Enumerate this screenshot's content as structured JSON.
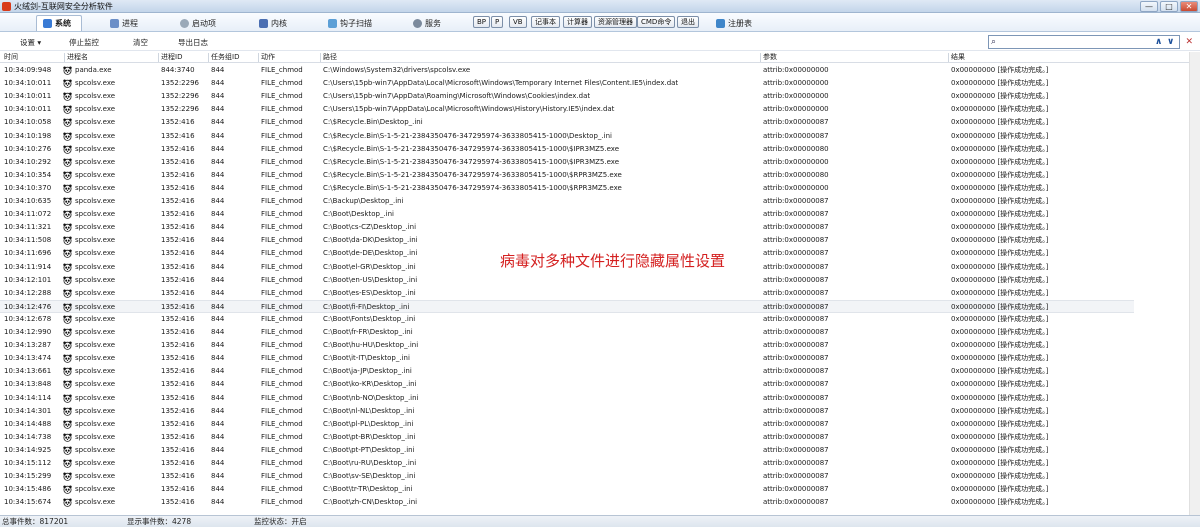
{
  "window": {
    "title": "火绒剑-互联网安全分析软件",
    "controls": [
      "—",
      "□",
      "✕"
    ]
  },
  "tabs": [
    {
      "label": "系统",
      "icon": "system-icon",
      "active": true
    },
    {
      "label": "进程",
      "icon": "process-icon"
    },
    {
      "label": "启动项",
      "icon": "startup-icon"
    },
    {
      "label": "内核",
      "icon": "kernel-icon"
    },
    {
      "label": "钩子扫描",
      "icon": "hook-scan-icon"
    },
    {
      "label": "服务",
      "icon": "service-icon"
    }
  ],
  "tools": [
    "BP",
    "P",
    "VB",
    "记事本",
    "计算器",
    "资源管理器",
    "CMD命令",
    "退出"
  ],
  "registry_label": "注册表",
  "actions": {
    "settings": "设置",
    "stop_monitor": "停止监控",
    "clear": "清空",
    "export_log": "导出日志"
  },
  "search": {
    "placeholder": ""
  },
  "columns": [
    "时间",
    "进程名",
    "进程ID",
    "任务组ID",
    "动作",
    "路径",
    "参数",
    "结果"
  ],
  "rows": [
    {
      "time": "10:34:09:948",
      "proc": "panda.exe",
      "pid": "844:3740",
      "gid": "844",
      "action": "FILE_chmod",
      "path": "C:\\Windows\\System32\\drivers\\spcolsv.exe",
      "param": "attrib:0x00000000",
      "result": "0x00000000 [操作成功完成。]"
    },
    {
      "time": "10:34:10:011",
      "proc": "spcolsv.exe",
      "pid": "1352:2296",
      "gid": "844",
      "action": "FILE_chmod",
      "path": "C:\\Users\\15pb-win7\\AppData\\Local\\Microsoft\\Windows\\Temporary Internet Files\\Content.IE5\\index.dat",
      "param": "attrib:0x00000000",
      "result": "0x00000000 [操作成功完成。]"
    },
    {
      "time": "10:34:10:011",
      "proc": "spcolsv.exe",
      "pid": "1352:2296",
      "gid": "844",
      "action": "FILE_chmod",
      "path": "C:\\Users\\15pb-win7\\AppData\\Roaming\\Microsoft\\Windows\\Cookies\\index.dat",
      "param": "attrib:0x00000000",
      "result": "0x00000000 [操作成功完成。]"
    },
    {
      "time": "10:34:10:011",
      "proc": "spcolsv.exe",
      "pid": "1352:2296",
      "gid": "844",
      "action": "FILE_chmod",
      "path": "C:\\Users\\15pb-win7\\AppData\\Local\\Microsoft\\Windows\\History\\History.IE5\\index.dat",
      "param": "attrib:0x00000000",
      "result": "0x00000000 [操作成功完成。]"
    },
    {
      "time": "10:34:10:058",
      "proc": "spcolsv.exe",
      "pid": "1352:416",
      "gid": "844",
      "action": "FILE_chmod",
      "path": "C:\\$Recycle.Bin\\Desktop_.ini",
      "param": "attrib:0x00000087",
      "result": "0x00000000 [操作成功完成。]"
    },
    {
      "time": "10:34:10:198",
      "proc": "spcolsv.exe",
      "pid": "1352:416",
      "gid": "844",
      "action": "FILE_chmod",
      "path": "C:\\$Recycle.Bin\\S-1-5-21-2384350476-347295974-3633805415-1000\\Desktop_.ini",
      "param": "attrib:0x00000087",
      "result": "0x00000000 [操作成功完成。]"
    },
    {
      "time": "10:34:10:276",
      "proc": "spcolsv.exe",
      "pid": "1352:416",
      "gid": "844",
      "action": "FILE_chmod",
      "path": "C:\\$Recycle.Bin\\S-1-5-21-2384350476-347295974-3633805415-1000\\$IPR3MZ5.exe",
      "param": "attrib:0x00000080",
      "result": "0x00000000 [操作成功完成。]"
    },
    {
      "time": "10:34:10:292",
      "proc": "spcolsv.exe",
      "pid": "1352:416",
      "gid": "844",
      "action": "FILE_chmod",
      "path": "C:\\$Recycle.Bin\\S-1-5-21-2384350476-347295974-3633805415-1000\\$IPR3MZ5.exe",
      "param": "attrib:0x00000000",
      "result": "0x00000000 [操作成功完成。]"
    },
    {
      "time": "10:34:10:354",
      "proc": "spcolsv.exe",
      "pid": "1352:416",
      "gid": "844",
      "action": "FILE_chmod",
      "path": "C:\\$Recycle.Bin\\S-1-5-21-2384350476-347295974-3633805415-1000\\$RPR3MZ5.exe",
      "param": "attrib:0x00000080",
      "result": "0x00000000 [操作成功完成。]"
    },
    {
      "time": "10:34:10:370",
      "proc": "spcolsv.exe",
      "pid": "1352:416",
      "gid": "844",
      "action": "FILE_chmod",
      "path": "C:\\$Recycle.Bin\\S-1-5-21-2384350476-347295974-3633805415-1000\\$RPR3MZ5.exe",
      "param": "attrib:0x00000000",
      "result": "0x00000000 [操作成功完成。]"
    },
    {
      "time": "10:34:10:635",
      "proc": "spcolsv.exe",
      "pid": "1352:416",
      "gid": "844",
      "action": "FILE_chmod",
      "path": "C:\\Backup\\Desktop_.ini",
      "param": "attrib:0x00000087",
      "result": "0x00000000 [操作成功完成。]"
    },
    {
      "time": "10:34:11:072",
      "proc": "spcolsv.exe",
      "pid": "1352:416",
      "gid": "844",
      "action": "FILE_chmod",
      "path": "C:\\Boot\\Desktop_.ini",
      "param": "attrib:0x00000087",
      "result": "0x00000000 [操作成功完成。]"
    },
    {
      "time": "10:34:11:321",
      "proc": "spcolsv.exe",
      "pid": "1352:416",
      "gid": "844",
      "action": "FILE_chmod",
      "path": "C:\\Boot\\cs-CZ\\Desktop_.ini",
      "param": "attrib:0x00000087",
      "result": "0x00000000 [操作成功完成。]"
    },
    {
      "time": "10:34:11:508",
      "proc": "spcolsv.exe",
      "pid": "1352:416",
      "gid": "844",
      "action": "FILE_chmod",
      "path": "C:\\Boot\\da-DK\\Desktop_.ini",
      "param": "attrib:0x00000087",
      "result": "0x00000000 [操作成功完成。]"
    },
    {
      "time": "10:34:11:696",
      "proc": "spcolsv.exe",
      "pid": "1352:416",
      "gid": "844",
      "action": "FILE_chmod",
      "path": "C:\\Boot\\de-DE\\Desktop_.ini",
      "param": "attrib:0x00000087",
      "result": "0x00000000 [操作成功完成。]"
    },
    {
      "time": "10:34:11:914",
      "proc": "spcolsv.exe",
      "pid": "1352:416",
      "gid": "844",
      "action": "FILE_chmod",
      "path": "C:\\Boot\\el-GR\\Desktop_.ini",
      "param": "attrib:0x00000087",
      "result": "0x00000000 [操作成功完成。]"
    },
    {
      "time": "10:34:12:101",
      "proc": "spcolsv.exe",
      "pid": "1352:416",
      "gid": "844",
      "action": "FILE_chmod",
      "path": "C:\\Boot\\en-US\\Desktop_.ini",
      "param": "attrib:0x00000087",
      "result": "0x00000000 [操作成功完成。]"
    },
    {
      "time": "10:34:12:288",
      "proc": "spcolsv.exe",
      "pid": "1352:416",
      "gid": "844",
      "action": "FILE_chmod",
      "path": "C:\\Boot\\es-ES\\Desktop_.ini",
      "param": "attrib:0x00000087",
      "result": "0x00000000 [操作成功完成。]"
    },
    {
      "time": "10:34:12:476",
      "proc": "spcolsv.exe",
      "pid": "1352:416",
      "gid": "844",
      "action": "FILE_chmod",
      "path": "C:\\Boot\\fi-FI\\Desktop_.ini",
      "param": "attrib:0x00000087",
      "result": "0x00000000 [操作成功完成。]",
      "selected": true
    },
    {
      "time": "10:34:12:678",
      "proc": "spcolsv.exe",
      "pid": "1352:416",
      "gid": "844",
      "action": "FILE_chmod",
      "path": "C:\\Boot\\Fonts\\Desktop_.ini",
      "param": "attrib:0x00000087",
      "result": "0x00000000 [操作成功完成。]"
    },
    {
      "time": "10:34:12:990",
      "proc": "spcolsv.exe",
      "pid": "1352:416",
      "gid": "844",
      "action": "FILE_chmod",
      "path": "C:\\Boot\\fr-FR\\Desktop_.ini",
      "param": "attrib:0x00000087",
      "result": "0x00000000 [操作成功完成。]"
    },
    {
      "time": "10:34:13:287",
      "proc": "spcolsv.exe",
      "pid": "1352:416",
      "gid": "844",
      "action": "FILE_chmod",
      "path": "C:\\Boot\\hu-HU\\Desktop_.ini",
      "param": "attrib:0x00000087",
      "result": "0x00000000 [操作成功完成。]"
    },
    {
      "time": "10:34:13:474",
      "proc": "spcolsv.exe",
      "pid": "1352:416",
      "gid": "844",
      "action": "FILE_chmod",
      "path": "C:\\Boot\\it-IT\\Desktop_.ini",
      "param": "attrib:0x00000087",
      "result": "0x00000000 [操作成功完成。]"
    },
    {
      "time": "10:34:13:661",
      "proc": "spcolsv.exe",
      "pid": "1352:416",
      "gid": "844",
      "action": "FILE_chmod",
      "path": "C:\\Boot\\ja-JP\\Desktop_.ini",
      "param": "attrib:0x00000087",
      "result": "0x00000000 [操作成功完成。]"
    },
    {
      "time": "10:34:13:848",
      "proc": "spcolsv.exe",
      "pid": "1352:416",
      "gid": "844",
      "action": "FILE_chmod",
      "path": "C:\\Boot\\ko-KR\\Desktop_.ini",
      "param": "attrib:0x00000087",
      "result": "0x00000000 [操作成功完成。]"
    },
    {
      "time": "10:34:14:114",
      "proc": "spcolsv.exe",
      "pid": "1352:416",
      "gid": "844",
      "action": "FILE_chmod",
      "path": "C:\\Boot\\nb-NO\\Desktop_.ini",
      "param": "attrib:0x00000087",
      "result": "0x00000000 [操作成功完成。]"
    },
    {
      "time": "10:34:14:301",
      "proc": "spcolsv.exe",
      "pid": "1352:416",
      "gid": "844",
      "action": "FILE_chmod",
      "path": "C:\\Boot\\nl-NL\\Desktop_.ini",
      "param": "attrib:0x00000087",
      "result": "0x00000000 [操作成功完成。]"
    },
    {
      "time": "10:34:14:488",
      "proc": "spcolsv.exe",
      "pid": "1352:416",
      "gid": "844",
      "action": "FILE_chmod",
      "path": "C:\\Boot\\pl-PL\\Desktop_.ini",
      "param": "attrib:0x00000087",
      "result": "0x00000000 [操作成功完成。]"
    },
    {
      "time": "10:34:14:738",
      "proc": "spcolsv.exe",
      "pid": "1352:416",
      "gid": "844",
      "action": "FILE_chmod",
      "path": "C:\\Boot\\pt-BR\\Desktop_.ini",
      "param": "attrib:0x00000087",
      "result": "0x00000000 [操作成功完成。]"
    },
    {
      "time": "10:34:14:925",
      "proc": "spcolsv.exe",
      "pid": "1352:416",
      "gid": "844",
      "action": "FILE_chmod",
      "path": "C:\\Boot\\pt-PT\\Desktop_.ini",
      "param": "attrib:0x00000087",
      "result": "0x00000000 [操作成功完成。]"
    },
    {
      "time": "10:34:15:112",
      "proc": "spcolsv.exe",
      "pid": "1352:416",
      "gid": "844",
      "action": "FILE_chmod",
      "path": "C:\\Boot\\ru-RU\\Desktop_.ini",
      "param": "attrib:0x00000087",
      "result": "0x00000000 [操作成功完成。]"
    },
    {
      "time": "10:34:15:299",
      "proc": "spcolsv.exe",
      "pid": "1352:416",
      "gid": "844",
      "action": "FILE_chmod",
      "path": "C:\\Boot\\sv-SE\\Desktop_.ini",
      "param": "attrib:0x00000087",
      "result": "0x00000000 [操作成功完成。]"
    },
    {
      "time": "10:34:15:486",
      "proc": "spcolsv.exe",
      "pid": "1352:416",
      "gid": "844",
      "action": "FILE_chmod",
      "path": "C:\\Boot\\tr-TR\\Desktop_.ini",
      "param": "attrib:0x00000087",
      "result": "0x00000000 [操作成功完成。]"
    },
    {
      "time": "10:34:15:674",
      "proc": "spcolsv.exe",
      "pid": "1352:416",
      "gid": "844",
      "action": "FILE_chmod",
      "path": "C:\\Boot\\zh-CN\\Desktop_.ini",
      "param": "attrib:0x00000087",
      "result": "0x00000000 [操作成功完成。]"
    }
  ],
  "annotation": "病毒对多种文件进行隐藏属性设置",
  "status": {
    "total_events": "总事件数：817201",
    "shown_events": "显示事件数：4278",
    "monitor_state": "监控状态：开启"
  },
  "colors": {
    "annotation": "#d42020",
    "tab_active_bg": "#ffffff",
    "toolbar_bg": "#e8eff8"
  }
}
